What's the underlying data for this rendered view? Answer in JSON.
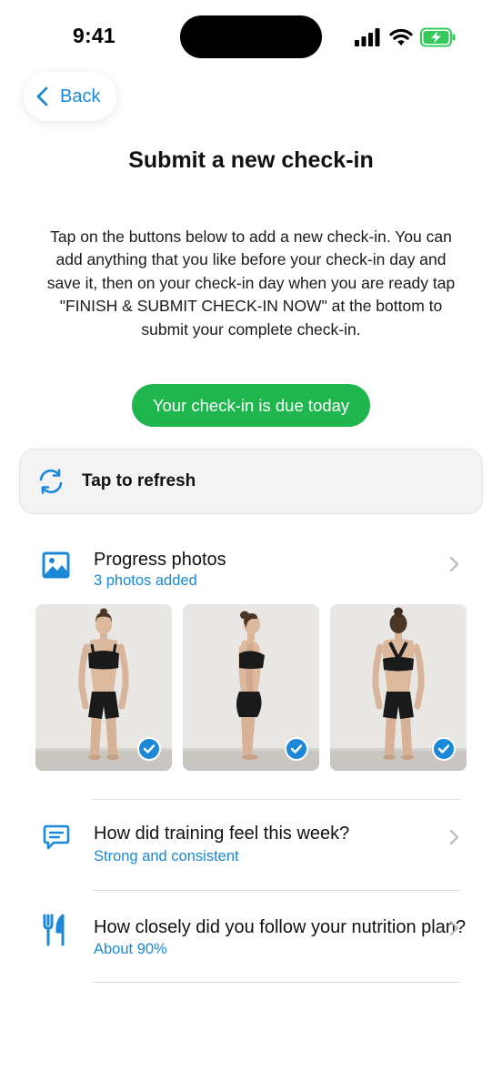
{
  "status_bar": {
    "time": "9:41"
  },
  "nav": {
    "back_label": "Back"
  },
  "page": {
    "title": "Submit a new check-in",
    "intro": "Tap on the buttons below to add a new check-in. You can add anything that you like before your check-in day and save it, then on your check-in day when you are ready tap \"FINISH & SUBMIT CHECK-IN NOW\" at the bottom to submit your complete check-in.",
    "due_label": "Your check-in is due today"
  },
  "refresh": {
    "label": "Tap to refresh"
  },
  "sections": {
    "photos": {
      "title": "Progress photos",
      "subtitle": "3 photos added"
    },
    "training": {
      "title": "How did training feel this week?",
      "answer": "Strong and consistent"
    },
    "nutrition": {
      "title": "How closely did you follow your nutrition plan?",
      "answer": "About 90%"
    }
  },
  "photos": [
    {
      "view": "front",
      "selected": true
    },
    {
      "view": "side",
      "selected": true
    },
    {
      "view": "back",
      "selected": true
    }
  ],
  "colors": {
    "accent": "#1b88d8",
    "success": "#1fb74d",
    "battery": "#34c759"
  },
  "icons": [
    "chevron-left-icon",
    "refresh-icon",
    "image-icon",
    "chat-icon",
    "fork-knife-icon",
    "chevron-right-icon",
    "check-icon"
  ]
}
